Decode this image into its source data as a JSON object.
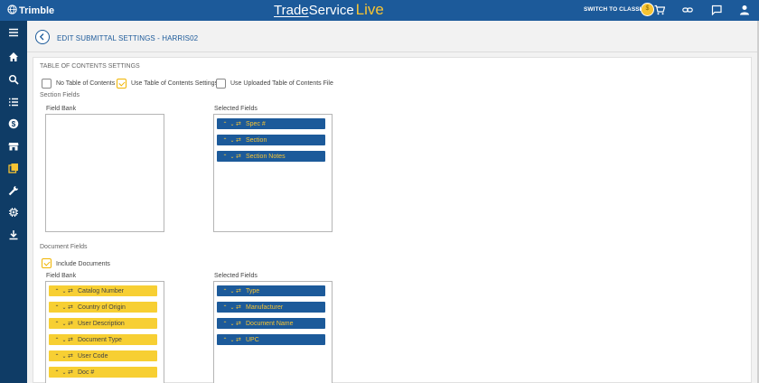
{
  "app": {
    "logo_text": "Trimble",
    "brand": {
      "part1": "Trade",
      "part2": "Service",
      "part3": "Live"
    },
    "switch_label": "SWITCH TO CLASSIC",
    "coin_label": "$"
  },
  "sidebar": {
    "icons": [
      "menu-icon",
      "home-icon",
      "search-icon",
      "list-icon",
      "dollar-icon",
      "store-icon",
      "submittals-icon",
      "wrench-icon",
      "chip-icon",
      "download-icon"
    ]
  },
  "page": {
    "title": "EDIT SUBMITTAL SETTINGS - HARRIS02"
  },
  "toc": {
    "heading": "TABLE OF CONTENTS SETTINGS",
    "options": [
      {
        "label": "No Table of Contents",
        "checked": false
      },
      {
        "label": "Use Table of Contents Settings",
        "checked": true
      },
      {
        "label": "Use Uploaded Table of Contents File",
        "checked": false
      }
    ]
  },
  "section_fields": {
    "heading": "Section Fields",
    "field_bank_label": "Field Bank",
    "selected_label": "Selected Fields",
    "field_bank": [],
    "selected": [
      "Spec #",
      "Section",
      "Section Notes"
    ]
  },
  "document_fields": {
    "heading": "Document Fields",
    "include_label": "Include Documents",
    "include_checked": true,
    "field_bank_label": "Field Bank",
    "selected_label": "Selected Fields",
    "field_bank": [
      "Catalog Number",
      "Country of Origin",
      "User Description",
      "Document Type",
      "User Code",
      "Doc #"
    ],
    "selected": [
      "Type",
      "Manufacturer",
      "Document Name",
      "UPC"
    ]
  },
  "colors": {
    "topbar": "#1c5a9a",
    "sidebar": "#0f3c66",
    "selected_field": "#1c5a9a",
    "bank_field": "#f7cf33",
    "accent": "#f7c433"
  }
}
